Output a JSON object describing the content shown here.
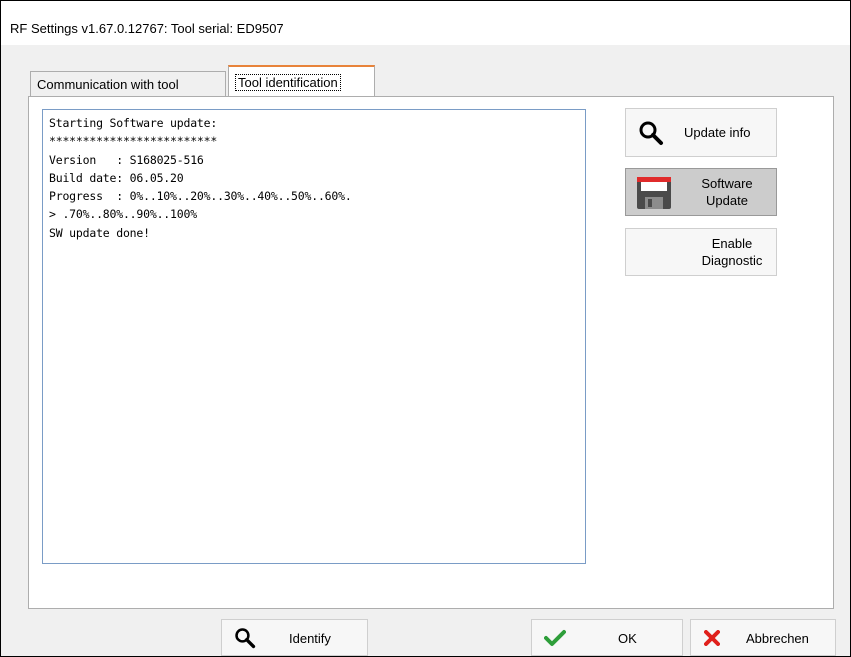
{
  "window": {
    "title": "RF Settings v1.67.0.12767: Tool serial: ED9507"
  },
  "tabs": [
    {
      "label": "Communication with tool",
      "active": false
    },
    {
      "label": "Tool identification",
      "active": true
    }
  ],
  "log": {
    "lines": [
      "Starting Software update:",
      "*************************",
      "Version   : S168025-516",
      "Build date: 06.05.20",
      "Progress  : 0%..10%..20%..30%..40%..50%..60%.",
      "> .70%..80%..90%..100%",
      "SW update done!"
    ]
  },
  "side_buttons": {
    "update_info": {
      "label": "Update info",
      "icon": "search-icon"
    },
    "software_update": {
      "label_line1": "Software",
      "label_line2": "Update",
      "icon": "floppy-disk-icon"
    },
    "enable_diagnostic": {
      "label_line1": "Enable",
      "label_line2": "Diagnostic"
    }
  },
  "footer": {
    "identify": {
      "label": "Identify",
      "icon": "search-icon"
    },
    "ok": {
      "label": "OK",
      "icon": "checkmark-icon",
      "color": "#2e9e3a"
    },
    "cancel": {
      "label": "Abbrechen",
      "icon": "close-icon",
      "color": "#e0201b"
    }
  },
  "colors": {
    "active_tab_accent": "#e8833a",
    "log_border": "#7a9cc6"
  }
}
